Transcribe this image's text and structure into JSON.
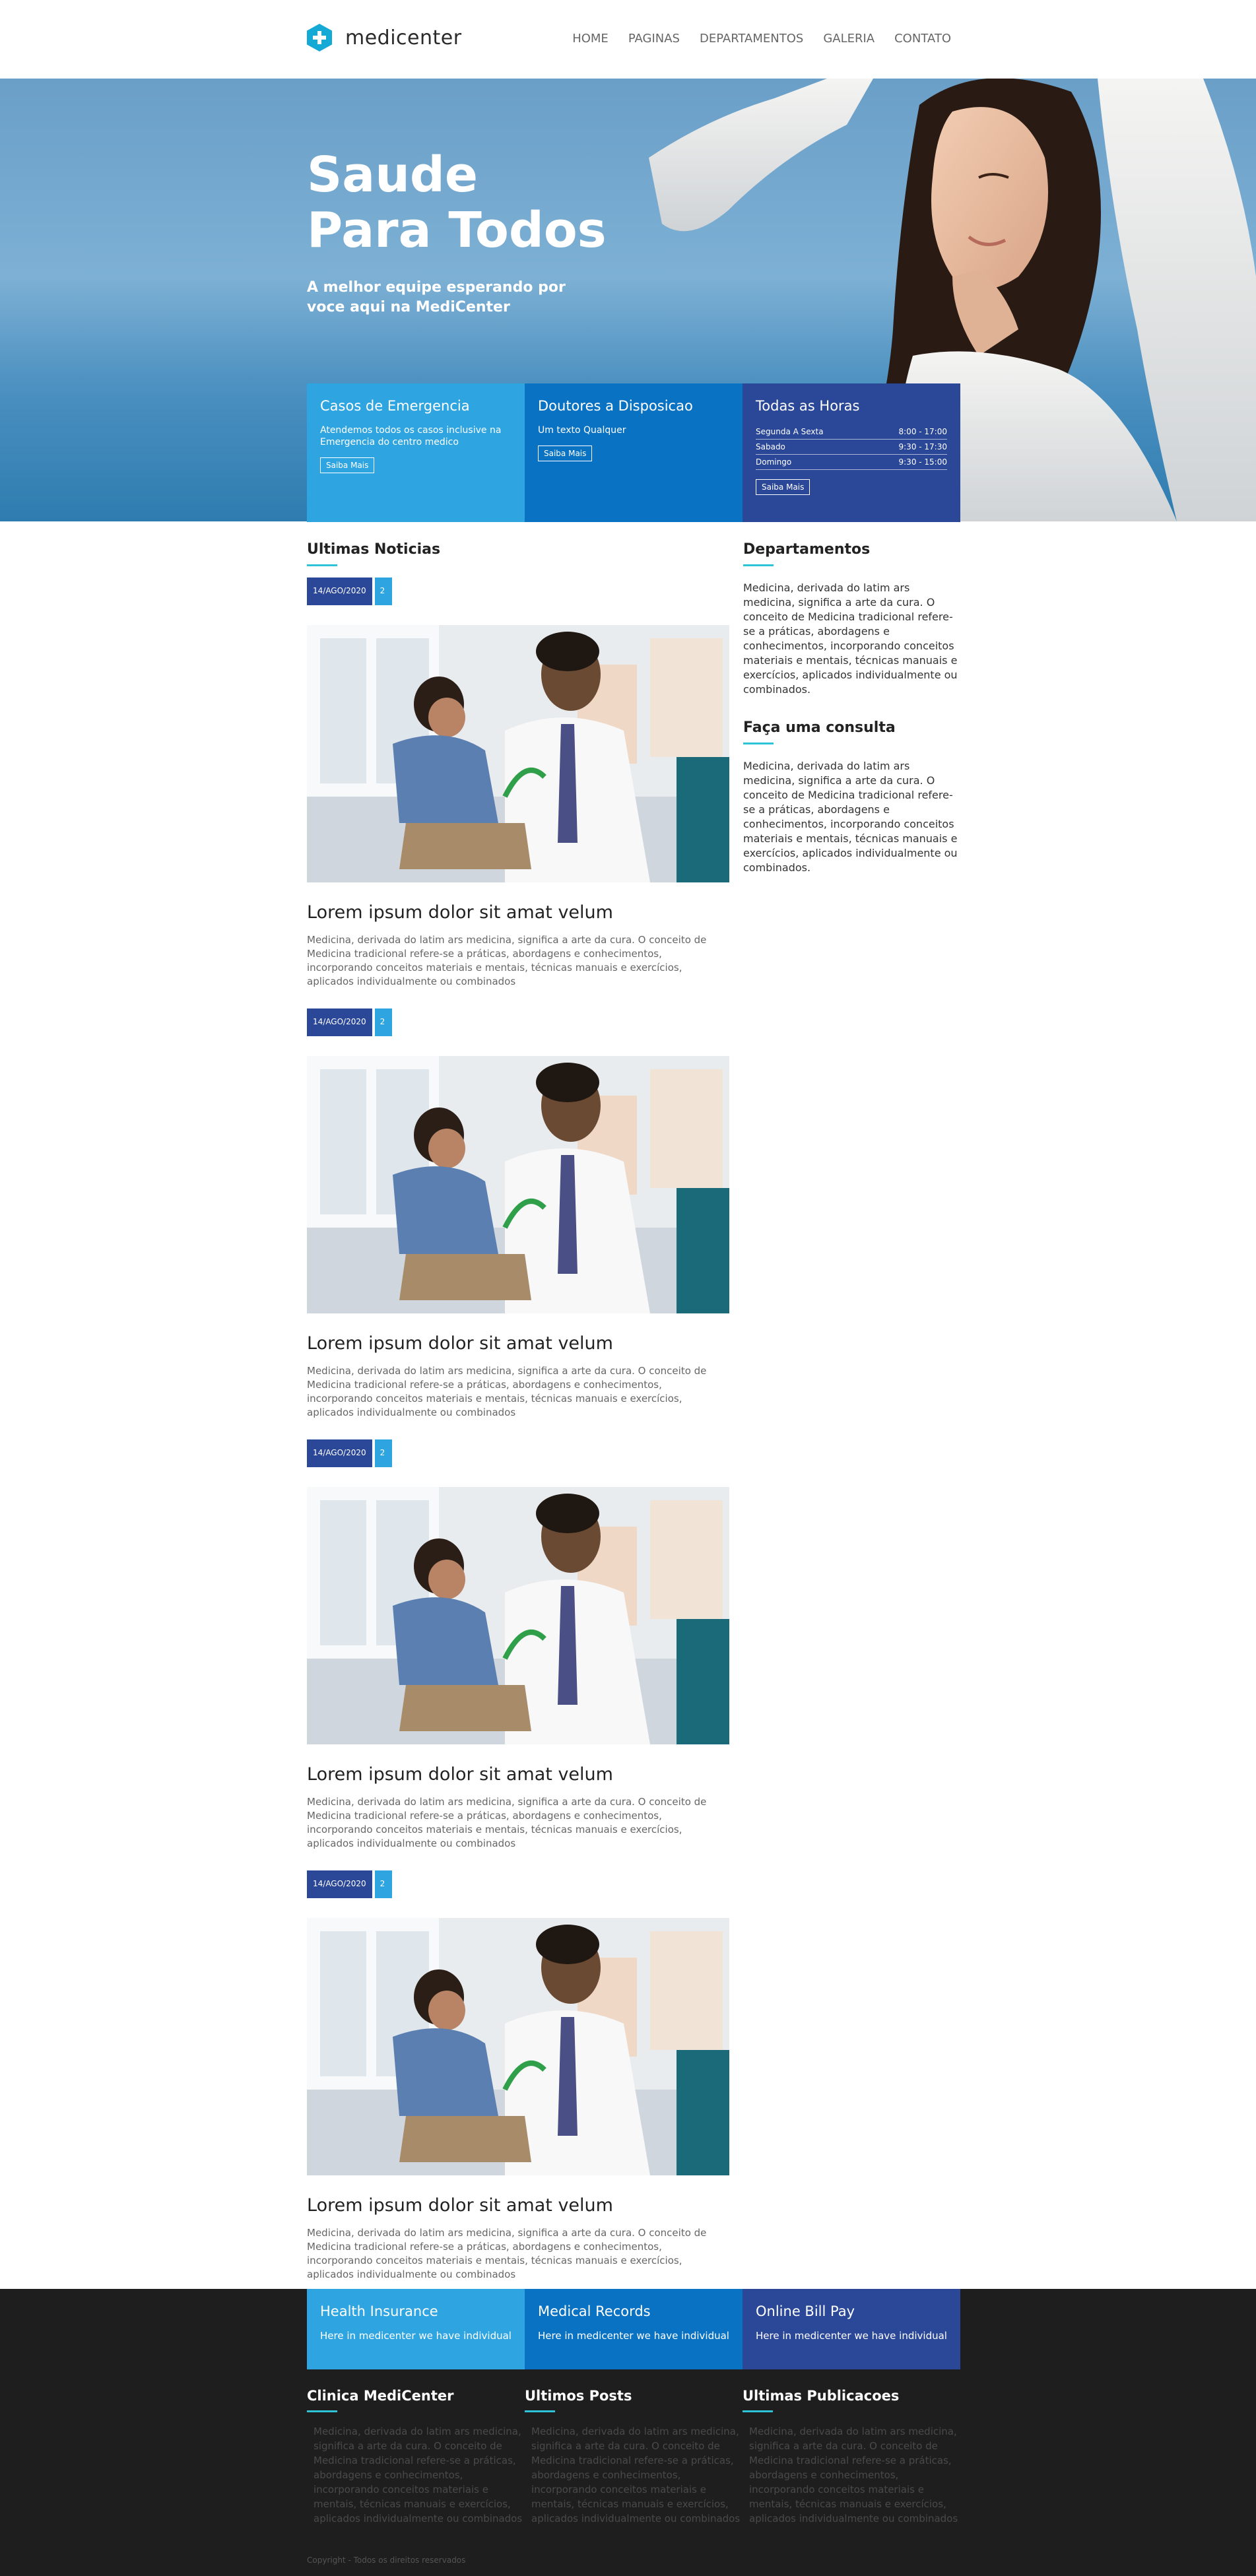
{
  "brand": {
    "name": "medicenter"
  },
  "nav": [
    "HOME",
    "PAGINAS",
    "DEPARTAMENTOS",
    "GALERIA",
    "CONTATO"
  ],
  "hero": {
    "title_line1": "Saude",
    "title_line2": "Para Todos",
    "subtitle": "A melhor equipe esperando por voce aqui na MediCenter"
  },
  "info_boxes": [
    {
      "title": "Casos de Emergencia",
      "text": "Atendemos todos os casos inclusive na Emergencia do centro medico",
      "button": "Saiba Mais",
      "color": "#2ea5e0"
    },
    {
      "title": "Doutores a Disposicao",
      "text": "Um texto Qualquer",
      "button": "Saiba Mais",
      "color": "#0a72c2"
    },
    {
      "title": "Todas as Horas",
      "button": "Saiba Mais",
      "color": "#2b4797",
      "hours": [
        {
          "day": "Segunda A Sexta",
          "time": "8:00 - 17:00"
        },
        {
          "day": "Sabado",
          "time": "9:30 - 17:30"
        },
        {
          "day": "Domingo",
          "time": "9:30 - 15:00"
        }
      ]
    }
  ],
  "news": {
    "title": "Ultimas Noticias",
    "posts": [
      {
        "date": "14/AGO/2020",
        "comments": "2",
        "heading": "Lorem ipsum dolor sit amat velum",
        "text": "Medicina, derivada do latim ars medicina, significa a arte da cura. O conceito de Medicina tradicional refere-se a práticas, abordagens e conhecimentos, incorporando conceitos materiais e mentais, técnicas manuais e exercícios, aplicados individualmente ou combinados"
      },
      {
        "date": "14/AGO/2020",
        "comments": "2",
        "heading": "Lorem ipsum dolor sit amat velum",
        "text": "Medicina, derivada do latim ars medicina, significa a arte da cura. O conceito de Medicina tradicional refere-se a práticas, abordagens e conhecimentos, incorporando conceitos materiais e mentais, técnicas manuais e exercícios, aplicados individualmente ou combinados"
      },
      {
        "date": "14/AGO/2020",
        "comments": "2",
        "heading": "Lorem ipsum dolor sit amat velum",
        "text": "Medicina, derivada do latim ars medicina, significa a arte da cura. O conceito de Medicina tradicional refere-se a práticas, abordagens e conhecimentos, incorporando conceitos materiais e mentais, técnicas manuais e exercícios, aplicados individualmente ou combinados"
      },
      {
        "date": "14/AGO/2020",
        "comments": "2",
        "heading": "Lorem ipsum dolor sit amat velum",
        "text": "Medicina, derivada do latim ars medicina, significa a arte da cura. O conceito de Medicina tradicional refere-se a práticas, abordagens e conhecimentos, incorporando conceitos materiais e mentais, técnicas manuais e exercícios, aplicados individualmente ou combinados"
      }
    ]
  },
  "sidebar": {
    "departments_title": "Departamentos",
    "departments_text": "Medicina, derivada do latim ars medicina, significa a arte da cura. O conceito de Medicina tradicional refere-se a práticas, abordagens e conhecimentos, incorporando conceitos materiais e mentais, técnicas manuais e exercícios, aplicados individualmente ou combinados.",
    "consult_title": "Faça uma consulta",
    "consult_text": "Medicina, derivada do latim ars medicina, significa a arte da cura. O conceito de Medicina tradicional refere-se a práticas, abordagens e conhecimentos, incorporando conceitos materiais e mentais, técnicas manuais e exercícios, aplicados individualmente ou combinados."
  },
  "footer": {
    "boxes": [
      {
        "title": "Health Insurance",
        "text": "Here in medicenter we have individual",
        "color": "#2ea5e0"
      },
      {
        "title": "Medical Records",
        "text": "Here in medicenter we have individual",
        "color": "#0a72c2"
      },
      {
        "title": "Online Bill Pay",
        "text": "Here in medicenter we have individual",
        "color": "#2b4797"
      }
    ],
    "columns": [
      {
        "title": "Clinica MediCenter",
        "text": "Medicina, derivada do latim ars medicina, significa a arte da cura. O conceito de Medicina tradicional refere-se a práticas, abordagens e conhecimentos, incorporando conceitos materiais e mentais, técnicas manuais e exercícios, aplicados individualmente ou combinados"
      },
      {
        "title": "Ultimos Posts",
        "text": "Medicina, derivada do latim ars medicina, significa a arte da cura. O conceito de Medicina tradicional refere-se a práticas, abordagens e conhecimentos, incorporando conceitos materiais e mentais, técnicas manuais e exercícios, aplicados individualmente ou combinados"
      },
      {
        "title": "Ultimas Publicacoes",
        "text": "Medicina, derivada do latim ars medicina, significa a arte da cura. O conceito de Medicina tradicional refere-se a práticas, abordagens e conhecimentos, incorporando conceitos materiais e mentais, técnicas manuais e exercícios, aplicados individualmente ou combinados"
      }
    ],
    "copyright": "Copyright - Todos os direitos reservados"
  },
  "colors": {
    "accent": "#2ec4d8",
    "light_blue": "#2ea5e0",
    "mid_blue": "#0a72c2",
    "dark_blue": "#2b4797",
    "footer_bg": "#1e1e1e"
  }
}
